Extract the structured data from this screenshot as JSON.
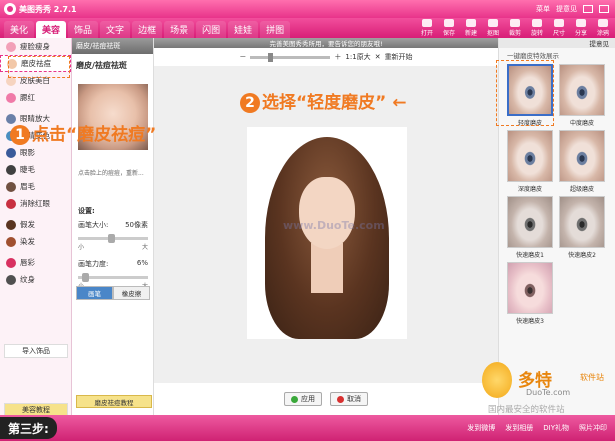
{
  "app": {
    "title": "美图秀秀 2.7.1",
    "menu": "菜单",
    "feedback": "提意见"
  },
  "tabs": [
    "美化",
    "美容",
    "饰品",
    "文字",
    "边框",
    "场景",
    "闪图",
    "娃娃",
    "拼图"
  ],
  "toolbar": [
    "打开",
    "保存",
    "新建",
    "抠图",
    "裁剪",
    "旋转",
    "尺寸",
    "分享",
    "涂鸦"
  ],
  "sidebar": {
    "items": [
      {
        "label": "瘦脸瘦身",
        "color": "#f2a0b8"
      },
      {
        "label": "磨皮祛痘",
        "color": "#f2c8a8"
      },
      {
        "label": "皮肤美白",
        "color": "#f6d4c0"
      },
      {
        "label": "腮红",
        "color": "#f07aa8"
      },
      {
        "label": "眼睛放大",
        "color": "#6a7fa8"
      },
      {
        "label": "眼睛变色",
        "color": "#4a8fc0"
      },
      {
        "label": "眼影",
        "color": "#3a5a9a"
      },
      {
        "label": "睫毛",
        "color": "#404040"
      },
      {
        "label": "眉毛",
        "color": "#705040"
      },
      {
        "label": "消除红眼",
        "color": "#c83040"
      },
      {
        "label": "假发",
        "color": "#5a3420"
      },
      {
        "label": "染发",
        "color": "#a05030"
      },
      {
        "label": "唇彩",
        "color": "#d83060"
      },
      {
        "label": "纹身",
        "color": "#505050"
      }
    ],
    "import_label": "导入饰品",
    "tutorial_label": "美容教程"
  },
  "panel": {
    "header": "磨皮/祛痘祛斑",
    "title": "磨皮/祛痘祛斑",
    "hint": "点击脸上的痘痘，重新...",
    "settings_label": "设置:",
    "brush_size_label": "画笔大小:",
    "brush_size_value": "50像素",
    "brush_strength_label": "画笔力度:",
    "brush_strength_value": "6%",
    "min_label": "小",
    "max_label": "大",
    "tab_brush": "画笔",
    "tab_eraser": "橡皮擦",
    "tutorial_button": "磨皮祛痘教程"
  },
  "canvas": {
    "notice": "完善美图秀秀所用，要告诉您的朋友哦!",
    "zoom_ratio": "1:1原大",
    "reset": "重新开始",
    "watermark": "www.DuoTe.com",
    "apply": "应用",
    "cancel": "取消"
  },
  "effects": {
    "header": "提意见",
    "subtitle": "一键磨皮特效展示",
    "items": [
      {
        "label": "轻度磨皮",
        "style": "blue",
        "selected": true
      },
      {
        "label": "中度磨皮",
        "style": "blue",
        "selected": false
      },
      {
        "label": "深度磨皮",
        "style": "blue",
        "selected": false
      },
      {
        "label": "超级磨皮",
        "style": "blue",
        "selected": false
      },
      {
        "label": "快速磨皮1",
        "style": "gray",
        "selected": false
      },
      {
        "label": "快速磨皮2",
        "style": "gray",
        "selected": false
      },
      {
        "label": "快速磨皮3",
        "style": "pink",
        "selected": false
      }
    ]
  },
  "callouts": {
    "step1_num": "1",
    "step1_text": "点击“磨皮祛痘”",
    "step2_num": "2",
    "step2_text": "选择“轻度磨皮”",
    "accent": "#f07a22"
  },
  "footer": {
    "step": "第三步:",
    "links": [
      "发到微博",
      "发到相册",
      "DIY礼物",
      "照片冲印"
    ],
    "site_name": "多特",
    "site_suffix": "软件站",
    "site_url": "DuoTe.com",
    "slogan": "国内最安全的软件站"
  }
}
